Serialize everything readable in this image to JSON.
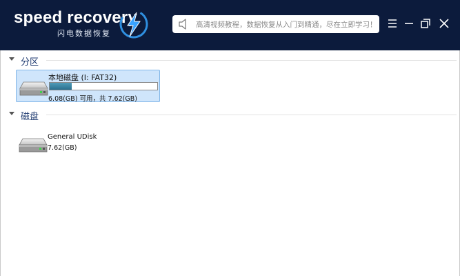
{
  "app": {
    "logo_text": "speed recovery",
    "logo_subtitle": "闪电数据恢复",
    "notice": "高清视频教程，数据恢复从入门到精通，尽在立即学习！",
    "brand_color": "#0c1b3c"
  },
  "groups": {
    "partition_label": "分区",
    "disk_label": "磁盘"
  },
  "partitions": [
    {
      "name": "本地磁盘 (I: FAT32)",
      "size_text": "6.08(GB) 可用，共 7.62(GB)",
      "used_fraction": 0.202,
      "selected": true
    }
  ],
  "disks": [
    {
      "name": "General UDisk",
      "size_text": "7.62(GB)"
    }
  ]
}
